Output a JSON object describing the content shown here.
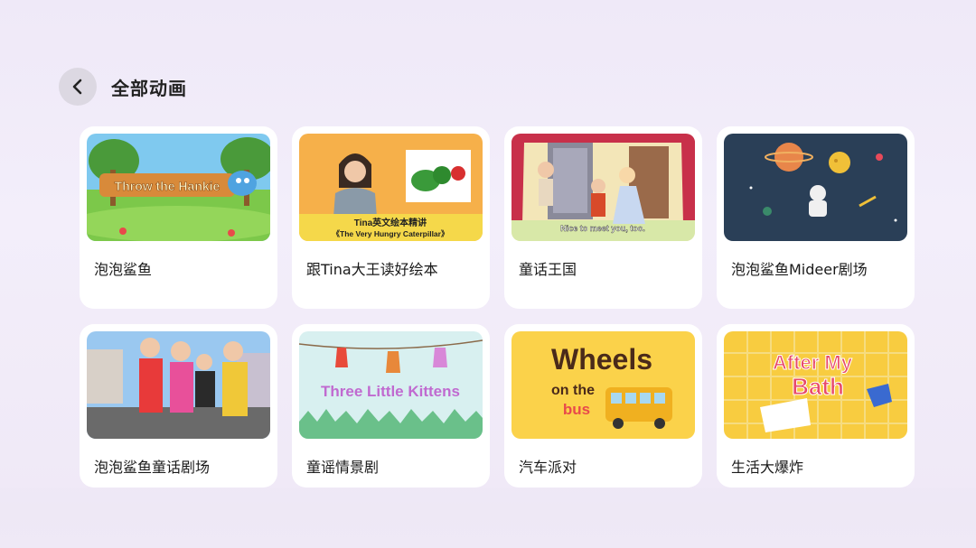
{
  "header": {
    "title": "全部动画"
  },
  "cards": [
    {
      "label": "泡泡鲨鱼",
      "thumb_text": "Throw the Hankie"
    },
    {
      "label": "跟Tina大王读好绘本",
      "thumb_text": "Tina英文绘本精讲",
      "thumb_sub": "《The Very Hungry Caterpillar》"
    },
    {
      "label": "童话王国",
      "thumb_text": "Nice to meet you, too."
    },
    {
      "label": "泡泡鲨鱼Mideer剧场"
    },
    {
      "label": "泡泡鲨鱼童话剧场"
    },
    {
      "label": "童谣情景剧",
      "thumb_text": "Three Little Kittens"
    },
    {
      "label": "汽车派对",
      "thumb_text": "Wheels",
      "thumb_text2": "on the",
      "thumb_text3": "bus"
    },
    {
      "label": "生活大爆炸",
      "thumb_text": "After My",
      "thumb_text2": "Bath"
    }
  ]
}
